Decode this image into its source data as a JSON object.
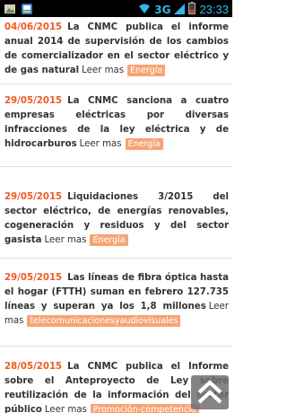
{
  "status_bar": {
    "network": "3G",
    "time": "23:33"
  },
  "news": [
    {
      "date": "04/06/2015",
      "title": "La CNMC publica el informe anual 2014 de supervisión de los cambios de comercializador en el sector eléctrico y de gas natural",
      "read_more": "Leer mas",
      "tag": "Energía"
    },
    {
      "date": "29/05/2015",
      "title": "La CNMC sanciona a cuatro empresas eléctricas por diversas infracciones de la ley eléctrica y de hidrocarburos",
      "read_more": "Leer mas",
      "tag": "Energía"
    },
    {
      "date": "29/05/2015",
      "title": "Liquidaciones 3/2015 del sector eléctrico, de energías renovables, cogeneración y residuos y del sector gasista",
      "read_more": "Leer mas",
      "tag": "Energía"
    },
    {
      "date": "29/05/2015",
      "title": "Las líneas de fibra óptica hasta el hogar (FTTH) suman en febrero 127.735 líneas y superan ya los 1,8 millones",
      "read_more": "Leer mas",
      "tag": "telecomunicacionesyaudiovisuales"
    },
    {
      "date": "28/05/2015",
      "title": "La CNMC publica el Informe sobre el Anteproyecto de Ley sobre reutilización de la información del sector público",
      "read_more": "Leer mas",
      "tag": "Promoción-competencia"
    }
  ]
}
